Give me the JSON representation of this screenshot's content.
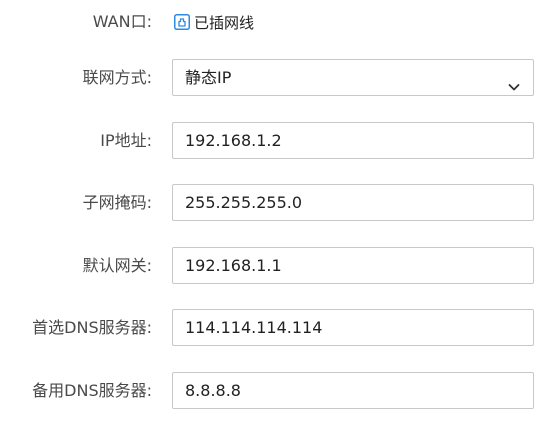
{
  "wan": {
    "label": "WAN口:",
    "status_text": "已插网线",
    "status_icon": "ethernet-port-icon",
    "accent_color": "#2a8ae6"
  },
  "connection_type": {
    "label": "联网方式:",
    "selected": "静态IP"
  },
  "ip_address": {
    "label": "IP地址:",
    "value": "192.168.1.2"
  },
  "subnet_mask": {
    "label": "子网掩码:",
    "value": "255.255.255.0"
  },
  "gateway": {
    "label": "默认网关:",
    "value": "192.168.1.1"
  },
  "primary_dns": {
    "label": "首选DNS服务器:",
    "value": "114.114.114.114"
  },
  "secondary_dns": {
    "label": "备用DNS服务器:",
    "value": "8.8.8.8"
  }
}
